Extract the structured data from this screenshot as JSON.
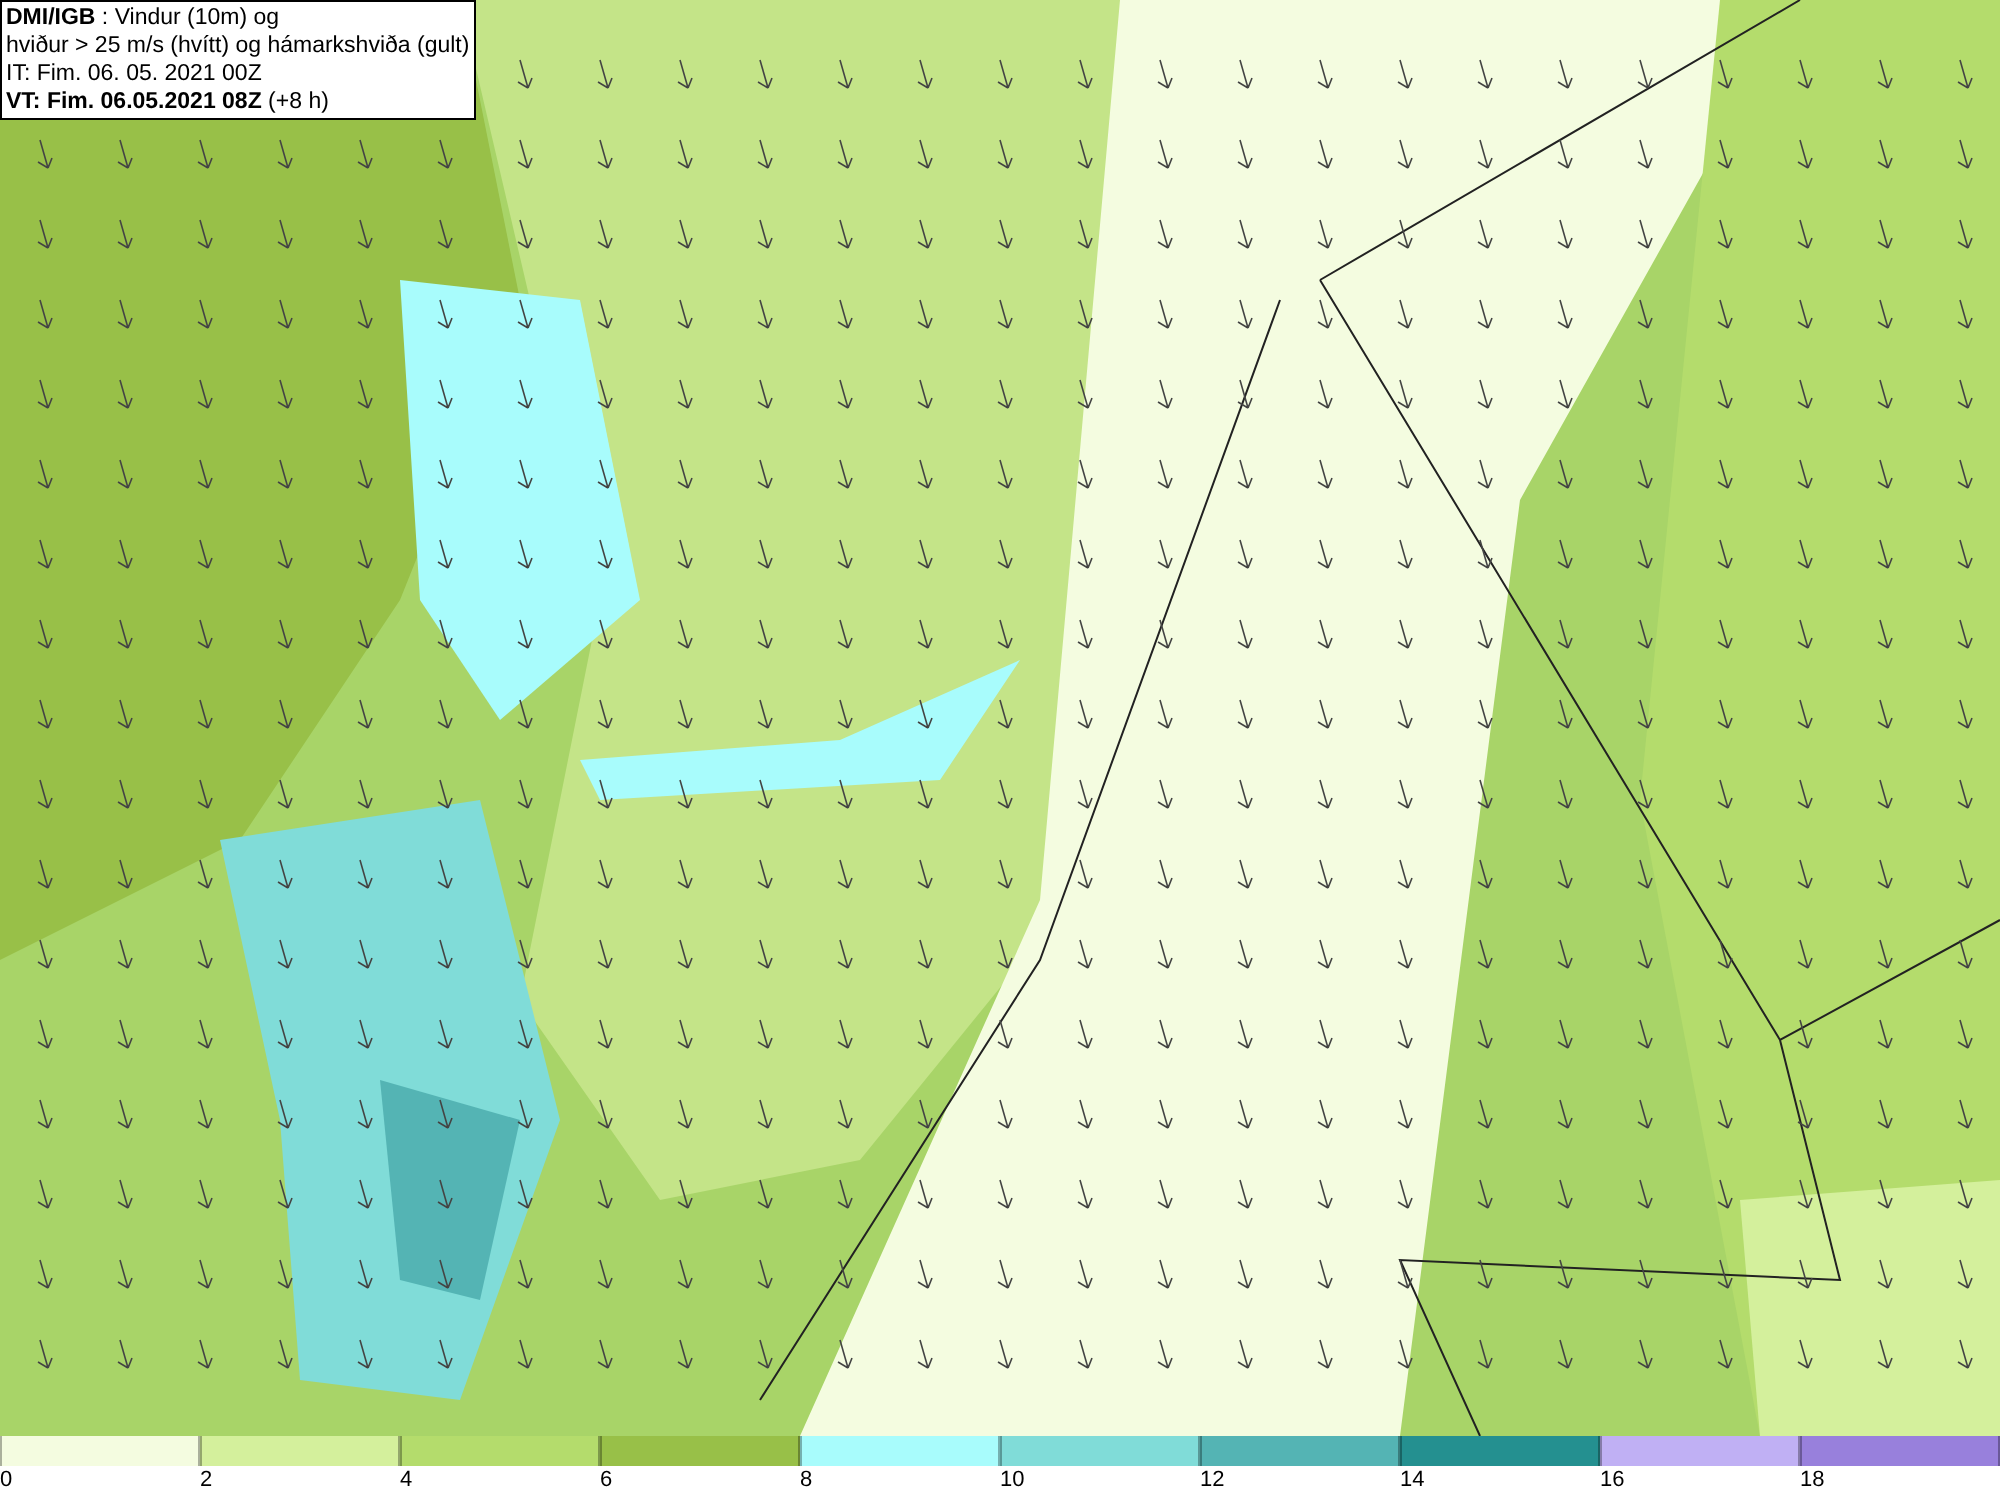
{
  "title_box": {
    "lines": [
      "**DMI/IGB** : Vindur (10m) og",
      "hviður > 25 m/s (hvítt) og hámarkshviða (gult)",
      "IT: Fim. 06. 05. 2021 00Z",
      "**VT: Fim. 06.05.2021 08Z** (+8 h)"
    ]
  },
  "legend": [
    {
      "label": "0",
      "color": "#f4fce0"
    },
    {
      "label": "2",
      "color": "#d4f09c"
    },
    {
      "label": "4",
      "color": "#b4dc6c"
    },
    {
      "label": "6",
      "color": "#98c048"
    },
    {
      "label": "8",
      "color": "#a8fcfc"
    },
    {
      "label": "10",
      "color": "#80dcd8"
    },
    {
      "label": "12",
      "color": "#54b4b4"
    },
    {
      "label": "14",
      "color": "#249090"
    },
    {
      "label": "16",
      "color": "#c0b0f4"
    },
    {
      "label": "18",
      "color": "#9880dc"
    }
  ]
}
